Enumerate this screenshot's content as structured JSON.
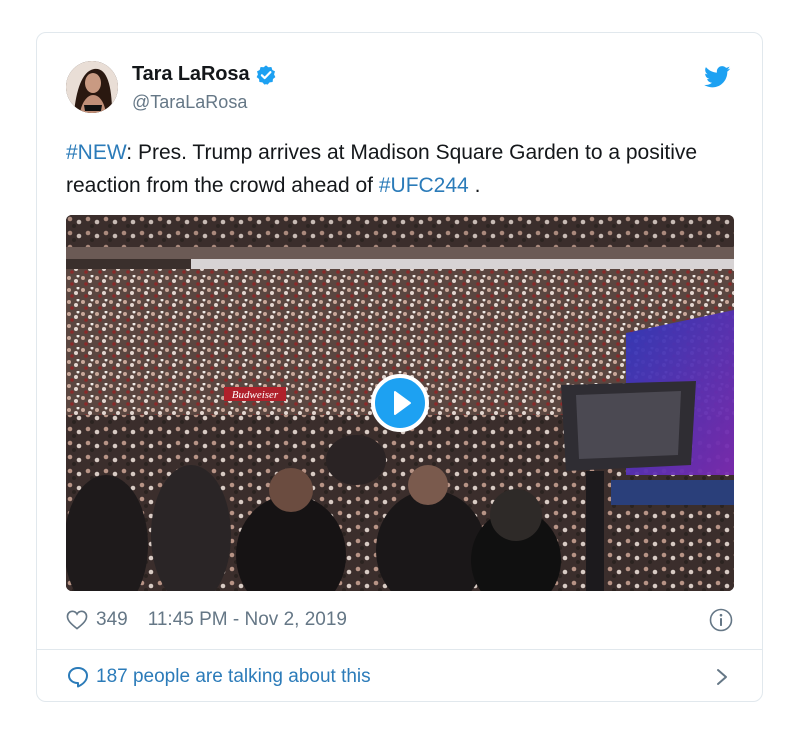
{
  "author": {
    "display_name": "Tara LaRosa",
    "handle": "@TaraLaRosa",
    "verified": true
  },
  "tweet": {
    "hashtag_new": "#NEW",
    "text_part1": ": Pres. Trump arrives at Madison Square Garden to a positive reaction from the crowd ahead of ",
    "hashtag_event": "#UFC244",
    "text_part2": " ."
  },
  "media": {
    "type": "video",
    "sign_text": "Budweiser"
  },
  "meta": {
    "likes": "349",
    "timestamp": "11:45 PM - Nov 2, 2019"
  },
  "footer": {
    "talking_label": "187 people are talking about this"
  },
  "colors": {
    "accent": "#1da1f2",
    "link": "#2b7bb9",
    "secondary_text": "#657786",
    "border": "#e1e8ed"
  },
  "icons": [
    "verified-badge-icon",
    "twitter-bird-icon",
    "play-icon",
    "heart-icon",
    "info-icon",
    "speech-bubble-icon",
    "chevron-right-icon"
  ]
}
